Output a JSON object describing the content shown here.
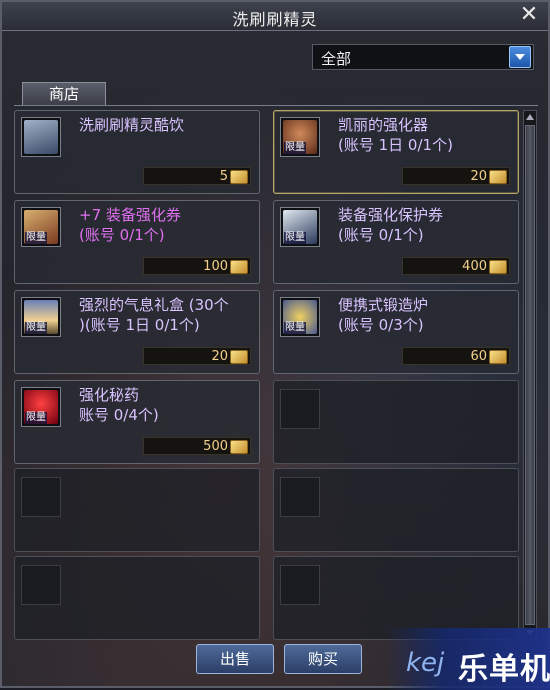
{
  "window": {
    "title": "洗刷刷精灵",
    "close_label": "✕"
  },
  "filter": {
    "selected": "全部"
  },
  "tabs": [
    {
      "label": "商店"
    }
  ],
  "items": [
    {
      "name": "洗刷刷精灵酷饮",
      "price": "5",
      "icon": "drink-icon",
      "color": "#d8c3ff",
      "limited": false
    },
    {
      "name": "凯丽的强化器",
      "note": "(账号 1日 0/1个)",
      "price": "20",
      "icon": "enhancer-icon",
      "color": "#d8c3ff",
      "limited": true,
      "limit_tag": "限量"
    },
    {
      "name": "+7 装备强化券",
      "note": "(账号 0/1个)",
      "price": "100",
      "icon": "ticket-icon",
      "color": "#e070f0",
      "limited": true,
      "limit_tag": "限量"
    },
    {
      "name": "装备强化保护券",
      "note": "(账号 0/1个)",
      "price": "400",
      "icon": "protect-ticket-icon",
      "color": "#d8c3ff",
      "limited": true,
      "limit_tag": "限量"
    },
    {
      "name": "强烈的气息礼盒 (30个",
      "note": ")(账号 1日 0/1个)",
      "price": "20",
      "icon": "giftbox-icon",
      "color": "#d8c3ff",
      "limited": true,
      "limit_tag": "限量"
    },
    {
      "name": "便携式锻造炉",
      "note": "(账号 0/3个)",
      "price": "60",
      "icon": "forge-icon",
      "color": "#d8c3ff",
      "limited": true,
      "limit_tag": "限量"
    },
    {
      "name": "强化秘药",
      "note": "账号 0/4个)",
      "price": "500",
      "icon": "potion-icon",
      "color": "#d8c3ff",
      "limited": true,
      "limit_tag": "限量"
    }
  ],
  "buttons": {
    "sell": "出售",
    "buy": "购买"
  },
  "watermark": {
    "left": "kej",
    "right": "乐单机"
  }
}
